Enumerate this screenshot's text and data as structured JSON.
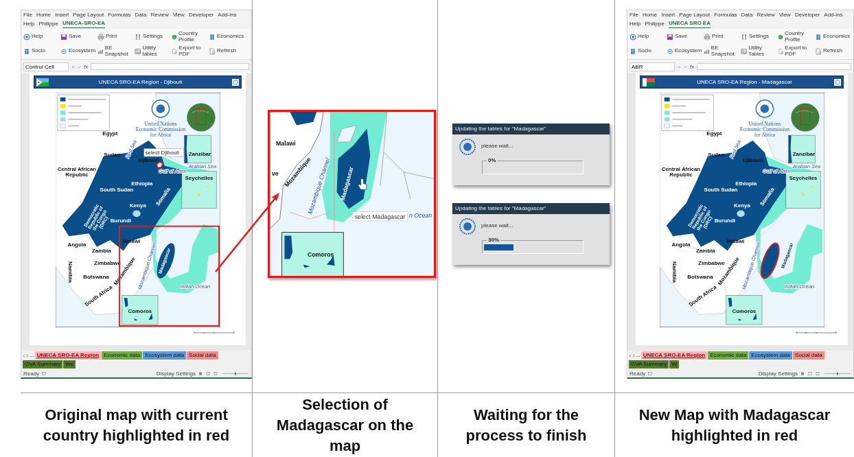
{
  "panels": [
    {
      "kind": "excel",
      "ribbon_tabs": [
        {
          "label": "File",
          "selected": false
        },
        {
          "label": "Home",
          "selected": false
        },
        {
          "label": "Insert",
          "selected": false
        },
        {
          "label": "Page Layout",
          "selected": false
        },
        {
          "label": "Formulas",
          "selected": false
        },
        {
          "label": "Data",
          "selected": false
        },
        {
          "label": "Review",
          "selected": false
        },
        {
          "label": "View",
          "selected": false
        },
        {
          "label": "Developer",
          "selected": false
        },
        {
          "label": "Add-ins",
          "selected": false
        },
        {
          "label": "Help",
          "selected": false
        },
        {
          "label": "Philippe",
          "selected": false
        },
        {
          "label": "UNECA-SRO-EA",
          "selected": true
        }
      ],
      "ribbon_buttons": [
        "Help",
        "Save",
        "Print",
        "Settings",
        "Country Profile",
        "Economics",
        "Socio",
        "Ecosystem",
        "BE Snapshot",
        "Utility tables",
        "Export to PDF",
        "Refresh"
      ],
      "name_box": "Control Cell",
      "function_label": "fx",
      "banner_title": "UNECA SRO-EA Region - Djibouti",
      "flag": {
        "kind": "djibouti"
      },
      "highlight": {
        "kind": "djibouti"
      },
      "selection_frame": true,
      "emblem_caption": [
        "United Nations",
        "Economic Commission",
        "for Africa"
      ],
      "map_labels": [
        {
          "text": "Egypt",
          "kind": "country"
        },
        {
          "text": "Red Sea",
          "kind": "sea"
        },
        {
          "text": "Zanzibar",
          "kind": "inset"
        },
        {
          "text": "Sudan",
          "kind": "country"
        },
        {
          "text": "Djibouti",
          "kind": "country"
        },
        {
          "text": "Arabian Sea",
          "kind": "sea"
        },
        {
          "text": "Gulf of Aden",
          "kind": "sea"
        },
        {
          "text": "Central African Republic",
          "kind": "country"
        },
        {
          "text": "Seychelles",
          "kind": "inset"
        },
        {
          "text": "Ethiopia",
          "kind": "region"
        },
        {
          "text": "South Sudan",
          "kind": "region"
        },
        {
          "text": "Somalia",
          "kind": "region"
        },
        {
          "text": "Kenya",
          "kind": "region"
        },
        {
          "text": "Democratic Republic of the Congo (DRC)",
          "kind": "region"
        },
        {
          "text": "Burundi",
          "kind": "region"
        },
        {
          "text": "Malawi",
          "kind": "country"
        },
        {
          "text": "Angola",
          "kind": "country"
        },
        {
          "text": "Zambia",
          "kind": "country"
        },
        {
          "text": "Madagascar",
          "kind": "region"
        },
        {
          "text": "Zimbabwe",
          "kind": "country"
        },
        {
          "text": "Mozambique Channel",
          "kind": "sea"
        },
        {
          "text": "Mozambique",
          "kind": "country"
        },
        {
          "text": "Namibia",
          "kind": "country"
        },
        {
          "text": "Botswana",
          "kind": "country"
        },
        {
          "text": "Indian Ocean",
          "kind": "sea"
        },
        {
          "text": "South Africa",
          "kind": "country"
        },
        {
          "text": "Comoros",
          "kind": "inset"
        }
      ],
      "map_tooltip": "select Djibouti",
      "sheet_nav_more": "...",
      "sheet_tabs": [
        {
          "label": "UNECA SRO-EA Region",
          "color": "#f4b6b6",
          "selected": true
        },
        {
          "label": "Economic data",
          "color": "#70ad47",
          "selected": false
        },
        {
          "label": "Ecosystem data",
          "color": "#5b9bd5",
          "selected": false
        },
        {
          "label": "Social data",
          "color": "#f08c8c",
          "selected": false
        },
        {
          "label": "GVA Summary",
          "color": "#4e7a2a",
          "selected": false
        },
        {
          "label": "We",
          "color": "#4e7a2a",
          "selected": false
        }
      ],
      "status_text": "Ready",
      "display_settings": "Display Settings",
      "caption": "Original map with current country highlighted in red"
    },
    {
      "kind": "zoom",
      "labels": [
        {
          "text": "Malawi",
          "kind": "country"
        },
        {
          "text": "ve",
          "kind": "country"
        },
        {
          "text": "Mozambique",
          "kind": "country"
        },
        {
          "text": "Mozambique Channel",
          "kind": "sea"
        },
        {
          "text": "Madagascar",
          "kind": "region"
        },
        {
          "text": "n Ocean",
          "kind": "sea"
        },
        {
          "text": "Comoros",
          "kind": "inset"
        }
      ],
      "tooltip": "select Madagascar",
      "caption": "Selection of Madagascar on the map"
    },
    {
      "kind": "progress",
      "dialogs": [
        {
          "title": "Updating the tables for \"Madagascar\"",
          "message": "please wait...",
          "percent": "0%",
          "level": 0
        },
        {
          "title": "Updating the tables for \"Madagascar\"",
          "message": "please wait...",
          "percent": "30%",
          "level": 0.3
        }
      ],
      "caption": "Waiting for the process to finish"
    },
    {
      "kind": "excel",
      "ribbon_tabs": [
        {
          "label": "File",
          "selected": false
        },
        {
          "label": "Home",
          "selected": false
        },
        {
          "label": "Insert",
          "selected": false
        },
        {
          "label": "Page Layout",
          "selected": false
        },
        {
          "label": "Formulas",
          "selected": false
        },
        {
          "label": "Data",
          "selected": false
        },
        {
          "label": "Review",
          "selected": false
        },
        {
          "label": "View",
          "selected": false
        },
        {
          "label": "Developer",
          "selected": false
        },
        {
          "label": "Add-ins",
          "selected": false
        },
        {
          "label": "Help",
          "selected": false
        },
        {
          "label": "Philippe",
          "selected": false
        },
        {
          "label": "UNECA SRO EA",
          "selected": true
        }
      ],
      "ribbon_buttons": [
        "Help",
        "Save",
        "Print",
        "Settings",
        "Country Profile",
        "Economics",
        "Socio",
        "Ecosystem",
        "BE Snapshot",
        "Utility Tables",
        "Export to PDF",
        "Refresh"
      ],
      "name_box": "ABR",
      "function_label": "fx",
      "banner_title": "UNECA SRO-EA Region - Madagascar",
      "flag": {
        "kind": "madagascar"
      },
      "highlight": {
        "kind": "madagascar"
      },
      "emblem_caption": [
        "United Nations",
        "Economic Commission",
        "for Africa"
      ],
      "map_labels": [
        {
          "text": "Egypt",
          "kind": "country"
        },
        {
          "text": "Red Sea",
          "kind": "sea"
        },
        {
          "text": "Zanzibar",
          "kind": "inset"
        },
        {
          "text": "Sudan",
          "kind": "country"
        },
        {
          "text": "Djibouti",
          "kind": "country"
        },
        {
          "text": "Arabian Sea",
          "kind": "sea"
        },
        {
          "text": "Gulf of Aden",
          "kind": "sea"
        },
        {
          "text": "Central African Republic",
          "kind": "country"
        },
        {
          "text": "Seychelles",
          "kind": "inset"
        },
        {
          "text": "Ethiopia",
          "kind": "region"
        },
        {
          "text": "South Sudan",
          "kind": "region"
        },
        {
          "text": "Somalia",
          "kind": "region"
        },
        {
          "text": "Kenya",
          "kind": "region"
        },
        {
          "text": "Democratic Republic of the Congo (DRC)",
          "kind": "region"
        },
        {
          "text": "Burundi",
          "kind": "region"
        },
        {
          "text": "Malawi",
          "kind": "country"
        },
        {
          "text": "Angola",
          "kind": "country"
        },
        {
          "text": "Zambia",
          "kind": "country"
        },
        {
          "text": "Madagascar",
          "kind": "region"
        },
        {
          "text": "Zimbabwe",
          "kind": "country"
        },
        {
          "text": "Mozambique Channel",
          "kind": "sea"
        },
        {
          "text": "Mozambique",
          "kind": "country"
        },
        {
          "text": "Namibia",
          "kind": "country"
        },
        {
          "text": "Botswana",
          "kind": "country"
        },
        {
          "text": "Indian Ocean",
          "kind": "sea"
        },
        {
          "text": "South Africa",
          "kind": "country"
        },
        {
          "text": "Comoros",
          "kind": "inset"
        }
      ],
      "sheet_nav_more": "...",
      "sheet_tabs": [
        {
          "label": "UNECA SRO-EA Region",
          "color": "#f4b6b6",
          "selected": true
        },
        {
          "label": "Economic data",
          "color": "#70ad47",
          "selected": false
        },
        {
          "label": "Ecosystem data",
          "color": "#5b9bd5",
          "selected": false
        },
        {
          "label": "Social data",
          "color": "#f08c8c",
          "selected": false
        },
        {
          "label": "GVA Summary",
          "color": "#4e7a2a",
          "selected": false
        },
        {
          "label": "W",
          "color": "#4e7a2a",
          "selected": false
        }
      ],
      "status_text": "Ready",
      "display_settings": "Display Settings",
      "caption": "New Map with Madagascar highlighted in red"
    }
  ]
}
